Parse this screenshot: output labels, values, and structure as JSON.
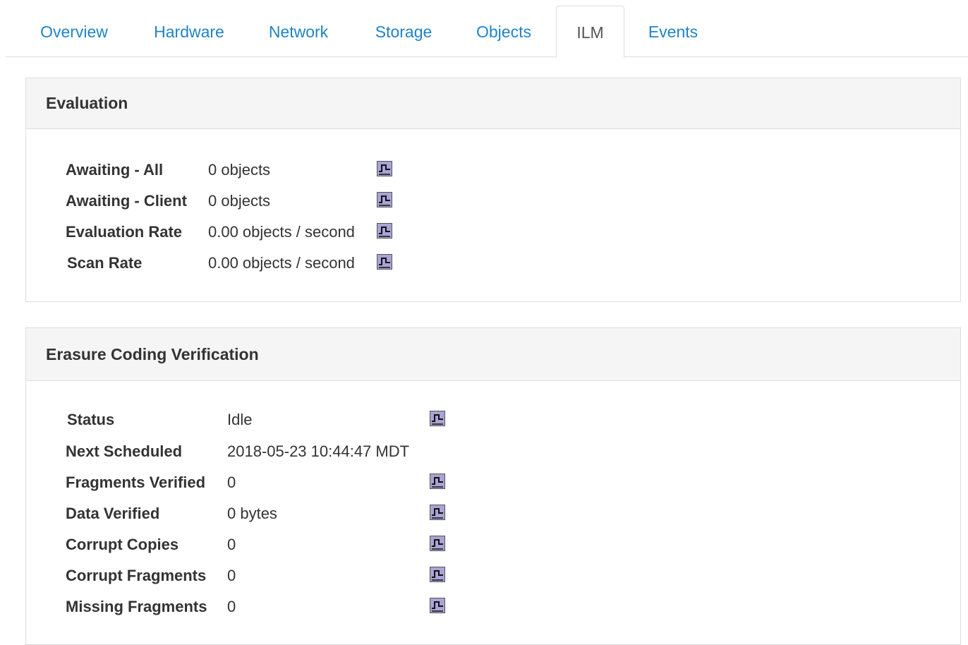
{
  "tabs": [
    {
      "label": "Overview",
      "active": false
    },
    {
      "label": "Hardware",
      "active": false
    },
    {
      "label": "Network",
      "active": false
    },
    {
      "label": "Storage",
      "active": false
    },
    {
      "label": "Objects",
      "active": false
    },
    {
      "label": "ILM",
      "active": true
    },
    {
      "label": "Events",
      "active": false
    }
  ],
  "evaluation": {
    "title": "Evaluation",
    "rows": [
      {
        "label": "Awaiting - All",
        "value": "0 objects",
        "chart_icon": "chart-icon"
      },
      {
        "label": "Awaiting - Client",
        "value": "0 objects",
        "chart_icon": "chart-icon"
      },
      {
        "label": "Evaluation Rate",
        "value": "0.00 objects / second",
        "chart_icon": "chart-icon"
      },
      {
        "label": "Scan Rate",
        "value": "0.00 objects / second",
        "chart_icon": "chart-icon"
      }
    ]
  },
  "ec_verification": {
    "title": "Erasure Coding Verification",
    "rows": [
      {
        "label": "Status",
        "value": "Idle",
        "chart_icon": "chart-icon"
      },
      {
        "label": "Next Scheduled",
        "value": "2018-05-23 10:44:47 MDT",
        "chart_icon": null
      },
      {
        "label": "Fragments Verified",
        "value": "0",
        "chart_icon": "chart-icon"
      },
      {
        "label": "Data Verified",
        "value": "0 bytes",
        "chart_icon": "chart-icon"
      },
      {
        "label": "Corrupt Copies",
        "value": "0",
        "chart_icon": "chart-icon"
      },
      {
        "label": "Corrupt Fragments",
        "value": "0",
        "chart_icon": "chart-icon"
      },
      {
        "label": "Missing Fragments",
        "value": "0",
        "chart_icon": "chart-icon"
      }
    ]
  },
  "colors": {
    "link": "#1f84c7",
    "active_tab_text": "#555555",
    "panel_heading_bg": "#f5f5f5",
    "border": "#dddddd",
    "chart_icon_bg": "#a9a3d6"
  }
}
